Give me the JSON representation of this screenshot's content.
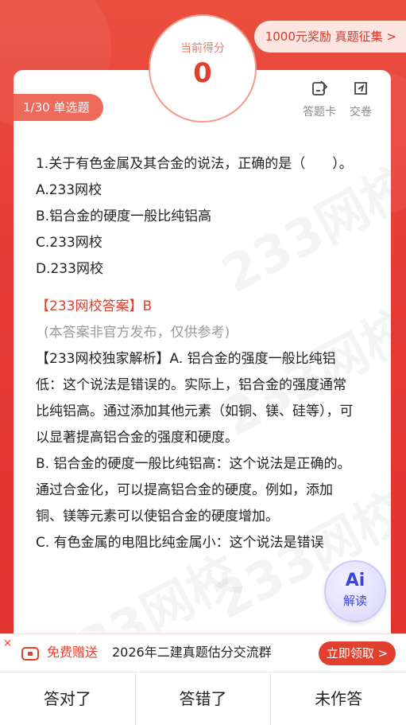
{
  "header": {
    "reward_text": "1000元奖励 真题征集 >",
    "score_label": "当前得分",
    "score_value": "0"
  },
  "card": {
    "type_tag": "1/30  单选题",
    "actions": [
      {
        "label": "答题卡",
        "icon": "answer-sheet-icon"
      },
      {
        "label": "交卷",
        "icon": "submit-paper-icon"
      }
    ]
  },
  "question": {
    "title": "1.关于有色金属及其合金的说法，正确的是（　　）。",
    "options": [
      "A.233网校",
      "B.铝合金的硬度一般比纯铝高",
      "C.233网校",
      "D.233网校"
    ]
  },
  "answer": {
    "answer_line": "【233网校答案】B",
    "disclaimer": "(本答案非官方发布，仅供参考)",
    "analysis_1": "【233网校独家解析】A. 铝合金的强度一般比纯铝低：这个说法是错误的。实际上，铝合金的强度通常比纯铝高。通过添加其他元素（如铜、镁、硅等），可以显著提高铝合金的强度和硬度。",
    "analysis_2": "B. 铝合金的硬度一般比纯铝高：这个说法是正确的。通过合金化，可以提高铝合金的硬度。例如，添加铜、镁等元素可以使铝合金的硬度增加。",
    "analysis_3": "C. 有色金属的电阻比纯金属小：这个说法是错误"
  },
  "ai": {
    "big": "Ai",
    "small": "解读"
  },
  "promo": {
    "close": "×",
    "free_label": "免费赠送",
    "text": "2026年二建真题估分交流群",
    "button": "立即领取 >"
  },
  "bottom_tabs": [
    "答对了",
    "答错了",
    "未作答"
  ],
  "watermark": "233网校",
  "colors": {
    "brand_red": "#e2402f",
    "tag_red": "#ef6a5b",
    "ai_blue": "#3a46d8"
  }
}
